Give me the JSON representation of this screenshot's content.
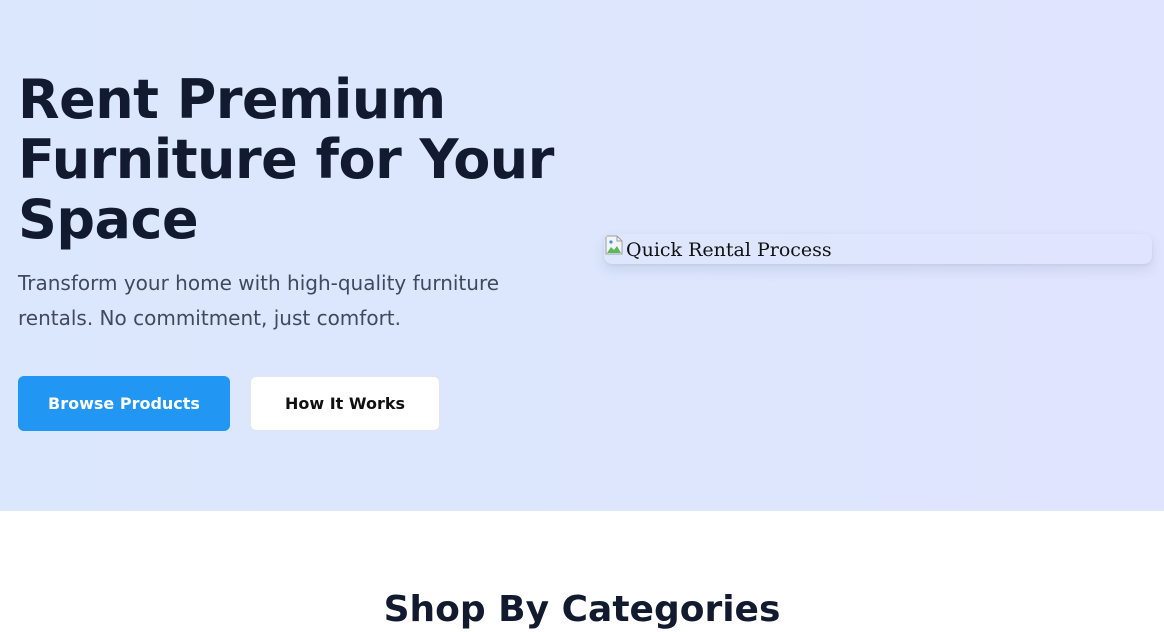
{
  "hero": {
    "title": "Rent Premium Furniture for Your Space",
    "subtitle": "Transform your home with high-quality furniture rentals. No commitment, just comfort.",
    "primary_button": "Browse Products",
    "secondary_button": "How It Works",
    "image": {
      "alt_text": "Quick Rental Process",
      "icon": "broken-image-icon"
    }
  },
  "categories": {
    "title": "Shop By Categories"
  },
  "colors": {
    "hero_background": "#dde6fd",
    "primary": "#2196f3",
    "heading": "#111a2e",
    "body_text": "#3f4a5c"
  }
}
